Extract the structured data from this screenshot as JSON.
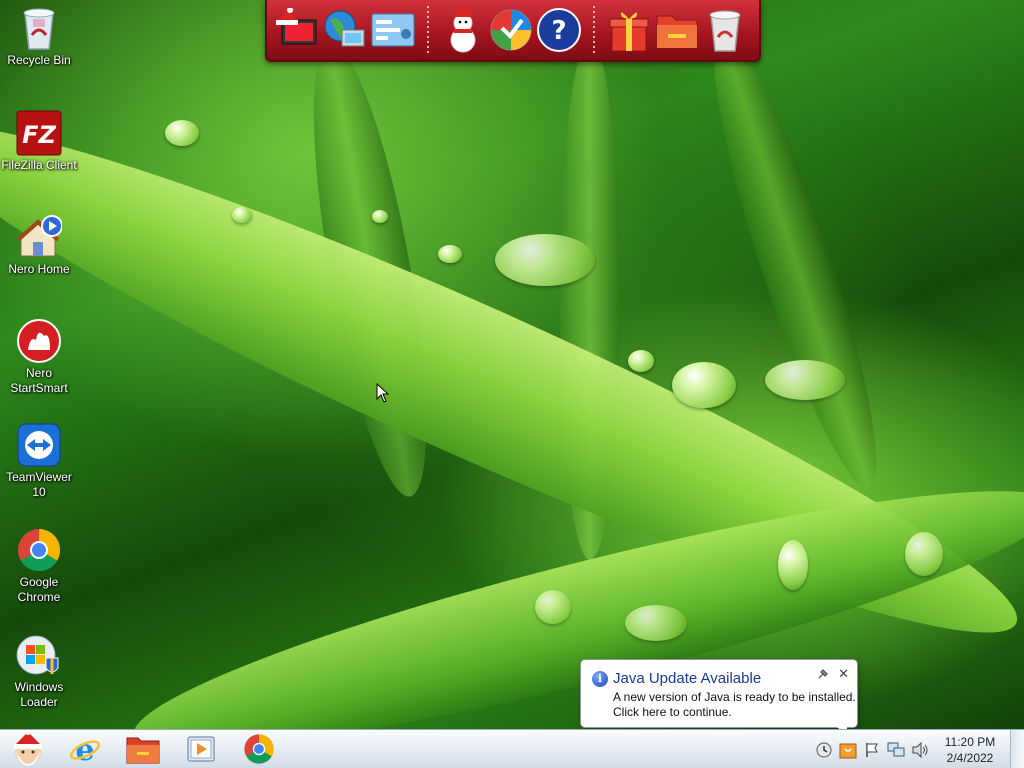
{
  "desktop": {
    "icons": [
      {
        "label": "Recycle Bin"
      },
      {
        "label": "FileZilla Client"
      },
      {
        "label": "Nero Home"
      },
      {
        "label": "Nero StartSmart"
      },
      {
        "label": "TeamViewer 10"
      },
      {
        "label": "Google Chrome"
      },
      {
        "label": "Windows Loader"
      }
    ]
  },
  "dock": {
    "items": [
      "santa-computer-icon",
      "globe-network-icon",
      "control-panel-icon",
      "snowman-icon",
      "windows-media-icon",
      "help-icon",
      "gift-icon",
      "folder-icon",
      "recycle-bin-icon"
    ]
  },
  "taskbar": {
    "pinned": [
      "internet-explorer-icon",
      "file-explorer-icon",
      "media-player-icon",
      "chrome-icon"
    ],
    "clock": {
      "time": "11:20 PM",
      "date": "2/4/2022"
    }
  },
  "notification": {
    "title": "Java Update Available",
    "line1": "A new version of Java is ready to be installed.",
    "line2": "Click here to continue.",
    "close": "✕"
  }
}
